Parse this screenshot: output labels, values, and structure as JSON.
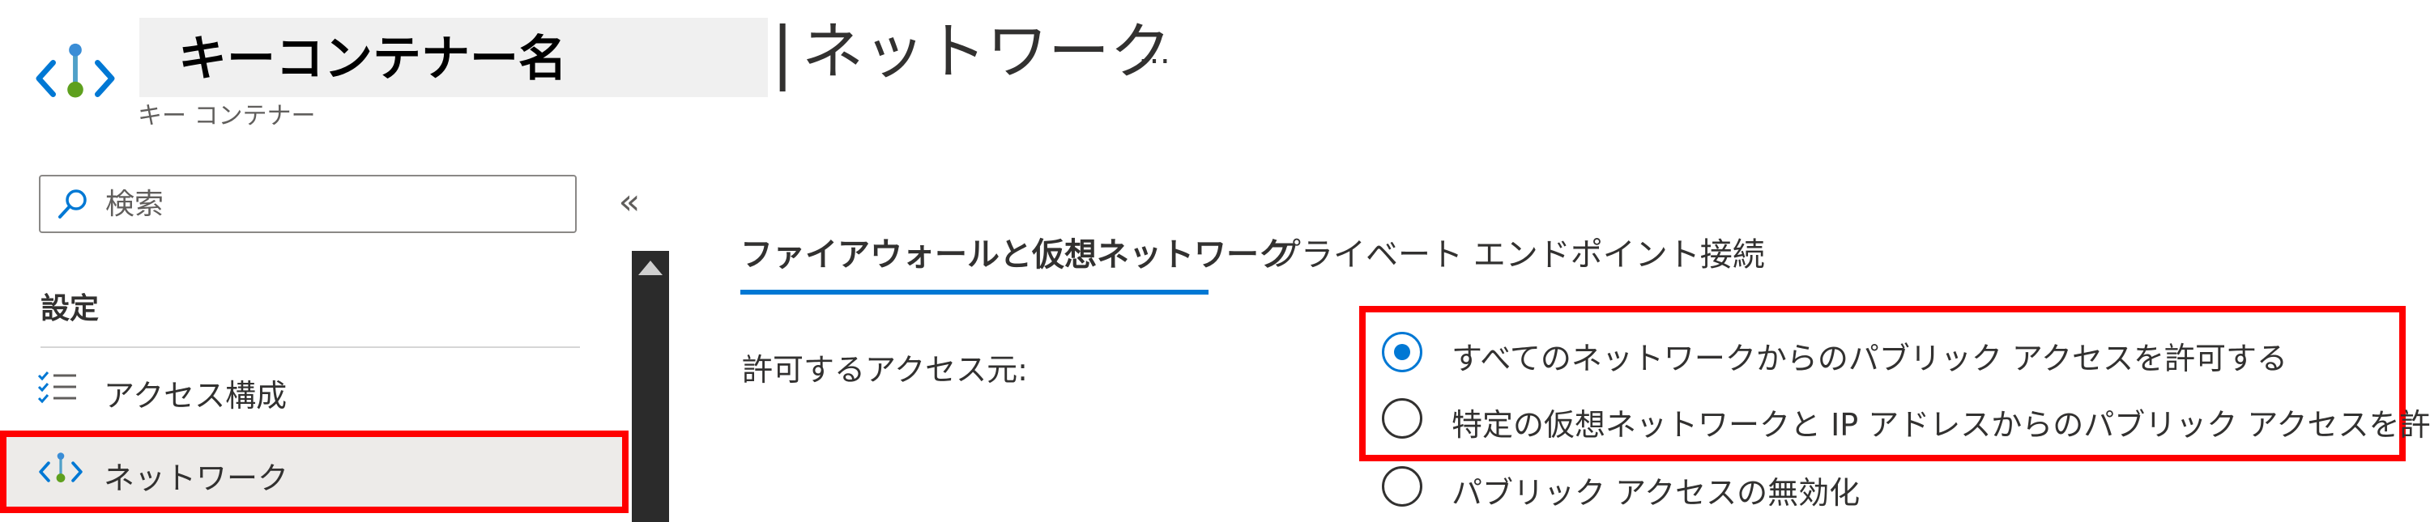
{
  "header": {
    "resource_name": "キーコンテナー名",
    "separator": "|",
    "page_title": "ネットワーク",
    "more_label": "…",
    "resource_type": "キー コンテナー"
  },
  "sidebar": {
    "search_placeholder": "検索",
    "collapse_label": "«",
    "section_title": "設定",
    "items": [
      {
        "label": "アクセス構成",
        "icon": "access-config-icon",
        "selected": false
      },
      {
        "label": "ネットワーク",
        "icon": "network-icon",
        "selected": true
      }
    ]
  },
  "tabs": [
    {
      "label": "ファイアウォールと仮想ネットワーク",
      "active": true
    },
    {
      "label": "プライベート エンドポイント接続",
      "active": false
    }
  ],
  "access": {
    "label": "許可するアクセス元:",
    "options": [
      {
        "label": "すべてのネットワークからのパブリック アクセスを許可する",
        "selected": true
      },
      {
        "label": "特定の仮想ネットワークと IP アドレスからのパブリック アクセスを許可する",
        "selected": false
      },
      {
        "label": "パブリック アクセスの無効化",
        "selected": false
      }
    ]
  },
  "colors": {
    "accent": "#0078d4",
    "highlight": "#ff0000",
    "icon_green": "#5ea01e",
    "icon_blue": "#0078d4"
  }
}
